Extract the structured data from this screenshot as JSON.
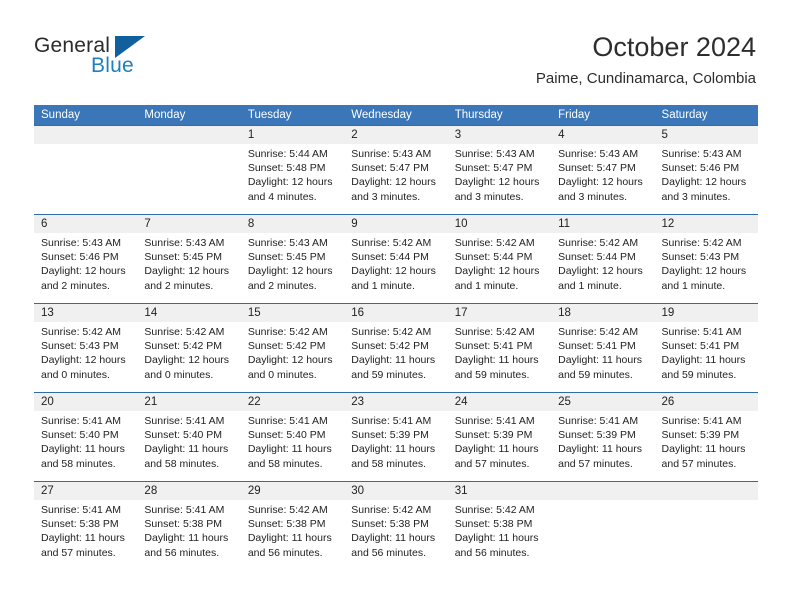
{
  "brand": {
    "word1": "General",
    "word2": "Blue",
    "accent_color": "#11609e",
    "blue_text_color": "#1f7fc4"
  },
  "header": {
    "title": "October 2024",
    "subtitle": "Paime, Cundinamarca, Colombia",
    "header_bg": "#3a76b8",
    "rule_color": "#2f6da8"
  },
  "calendar": {
    "weekdays": [
      "Sunday",
      "Monday",
      "Tuesday",
      "Wednesday",
      "Thursday",
      "Friday",
      "Saturday"
    ],
    "weeks": [
      [
        {
          "day": "",
          "sunrise": "",
          "sunset": "",
          "daylight1": "",
          "daylight2": ""
        },
        {
          "day": "",
          "sunrise": "",
          "sunset": "",
          "daylight1": "",
          "daylight2": ""
        },
        {
          "day": "1",
          "sunrise": "Sunrise: 5:44 AM",
          "sunset": "Sunset: 5:48 PM",
          "daylight1": "Daylight: 12 hours",
          "daylight2": "and 4 minutes."
        },
        {
          "day": "2",
          "sunrise": "Sunrise: 5:43 AM",
          "sunset": "Sunset: 5:47 PM",
          "daylight1": "Daylight: 12 hours",
          "daylight2": "and 3 minutes."
        },
        {
          "day": "3",
          "sunrise": "Sunrise: 5:43 AM",
          "sunset": "Sunset: 5:47 PM",
          "daylight1": "Daylight: 12 hours",
          "daylight2": "and 3 minutes."
        },
        {
          "day": "4",
          "sunrise": "Sunrise: 5:43 AM",
          "sunset": "Sunset: 5:47 PM",
          "daylight1": "Daylight: 12 hours",
          "daylight2": "and 3 minutes."
        },
        {
          "day": "5",
          "sunrise": "Sunrise: 5:43 AM",
          "sunset": "Sunset: 5:46 PM",
          "daylight1": "Daylight: 12 hours",
          "daylight2": "and 3 minutes."
        }
      ],
      [
        {
          "day": "6",
          "sunrise": "Sunrise: 5:43 AM",
          "sunset": "Sunset: 5:46 PM",
          "daylight1": "Daylight: 12 hours",
          "daylight2": "and 2 minutes."
        },
        {
          "day": "7",
          "sunrise": "Sunrise: 5:43 AM",
          "sunset": "Sunset: 5:45 PM",
          "daylight1": "Daylight: 12 hours",
          "daylight2": "and 2 minutes."
        },
        {
          "day": "8",
          "sunrise": "Sunrise: 5:43 AM",
          "sunset": "Sunset: 5:45 PM",
          "daylight1": "Daylight: 12 hours",
          "daylight2": "and 2 minutes."
        },
        {
          "day": "9",
          "sunrise": "Sunrise: 5:42 AM",
          "sunset": "Sunset: 5:44 PM",
          "daylight1": "Daylight: 12 hours",
          "daylight2": "and 1 minute."
        },
        {
          "day": "10",
          "sunrise": "Sunrise: 5:42 AM",
          "sunset": "Sunset: 5:44 PM",
          "daylight1": "Daylight: 12 hours",
          "daylight2": "and 1 minute."
        },
        {
          "day": "11",
          "sunrise": "Sunrise: 5:42 AM",
          "sunset": "Sunset: 5:44 PM",
          "daylight1": "Daylight: 12 hours",
          "daylight2": "and 1 minute."
        },
        {
          "day": "12",
          "sunrise": "Sunrise: 5:42 AM",
          "sunset": "Sunset: 5:43 PM",
          "daylight1": "Daylight: 12 hours",
          "daylight2": "and 1 minute."
        }
      ],
      [
        {
          "day": "13",
          "sunrise": "Sunrise: 5:42 AM",
          "sunset": "Sunset: 5:43 PM",
          "daylight1": "Daylight: 12 hours",
          "daylight2": "and 0 minutes."
        },
        {
          "day": "14",
          "sunrise": "Sunrise: 5:42 AM",
          "sunset": "Sunset: 5:42 PM",
          "daylight1": "Daylight: 12 hours",
          "daylight2": "and 0 minutes."
        },
        {
          "day": "15",
          "sunrise": "Sunrise: 5:42 AM",
          "sunset": "Sunset: 5:42 PM",
          "daylight1": "Daylight: 12 hours",
          "daylight2": "and 0 minutes."
        },
        {
          "day": "16",
          "sunrise": "Sunrise: 5:42 AM",
          "sunset": "Sunset: 5:42 PM",
          "daylight1": "Daylight: 11 hours",
          "daylight2": "and 59 minutes."
        },
        {
          "day": "17",
          "sunrise": "Sunrise: 5:42 AM",
          "sunset": "Sunset: 5:41 PM",
          "daylight1": "Daylight: 11 hours",
          "daylight2": "and 59 minutes."
        },
        {
          "day": "18",
          "sunrise": "Sunrise: 5:42 AM",
          "sunset": "Sunset: 5:41 PM",
          "daylight1": "Daylight: 11 hours",
          "daylight2": "and 59 minutes."
        },
        {
          "day": "19",
          "sunrise": "Sunrise: 5:41 AM",
          "sunset": "Sunset: 5:41 PM",
          "daylight1": "Daylight: 11 hours",
          "daylight2": "and 59 minutes."
        }
      ],
      [
        {
          "day": "20",
          "sunrise": "Sunrise: 5:41 AM",
          "sunset": "Sunset: 5:40 PM",
          "daylight1": "Daylight: 11 hours",
          "daylight2": "and 58 minutes."
        },
        {
          "day": "21",
          "sunrise": "Sunrise: 5:41 AM",
          "sunset": "Sunset: 5:40 PM",
          "daylight1": "Daylight: 11 hours",
          "daylight2": "and 58 minutes."
        },
        {
          "day": "22",
          "sunrise": "Sunrise: 5:41 AM",
          "sunset": "Sunset: 5:40 PM",
          "daylight1": "Daylight: 11 hours",
          "daylight2": "and 58 minutes."
        },
        {
          "day": "23",
          "sunrise": "Sunrise: 5:41 AM",
          "sunset": "Sunset: 5:39 PM",
          "daylight1": "Daylight: 11 hours",
          "daylight2": "and 58 minutes."
        },
        {
          "day": "24",
          "sunrise": "Sunrise: 5:41 AM",
          "sunset": "Sunset: 5:39 PM",
          "daylight1": "Daylight: 11 hours",
          "daylight2": "and 57 minutes."
        },
        {
          "day": "25",
          "sunrise": "Sunrise: 5:41 AM",
          "sunset": "Sunset: 5:39 PM",
          "daylight1": "Daylight: 11 hours",
          "daylight2": "and 57 minutes."
        },
        {
          "day": "26",
          "sunrise": "Sunrise: 5:41 AM",
          "sunset": "Sunset: 5:39 PM",
          "daylight1": "Daylight: 11 hours",
          "daylight2": "and 57 minutes."
        }
      ],
      [
        {
          "day": "27",
          "sunrise": "Sunrise: 5:41 AM",
          "sunset": "Sunset: 5:38 PM",
          "daylight1": "Daylight: 11 hours",
          "daylight2": "and 57 minutes."
        },
        {
          "day": "28",
          "sunrise": "Sunrise: 5:41 AM",
          "sunset": "Sunset: 5:38 PM",
          "daylight1": "Daylight: 11 hours",
          "daylight2": "and 56 minutes."
        },
        {
          "day": "29",
          "sunrise": "Sunrise: 5:42 AM",
          "sunset": "Sunset: 5:38 PM",
          "daylight1": "Daylight: 11 hours",
          "daylight2": "and 56 minutes."
        },
        {
          "day": "30",
          "sunrise": "Sunrise: 5:42 AM",
          "sunset": "Sunset: 5:38 PM",
          "daylight1": "Daylight: 11 hours",
          "daylight2": "and 56 minutes."
        },
        {
          "day": "31",
          "sunrise": "Sunrise: 5:42 AM",
          "sunset": "Sunset: 5:38 PM",
          "daylight1": "Daylight: 11 hours",
          "daylight2": "and 56 minutes."
        },
        {
          "day": "",
          "sunrise": "",
          "sunset": "",
          "daylight1": "",
          "daylight2": ""
        },
        {
          "day": "",
          "sunrise": "",
          "sunset": "",
          "daylight1": "",
          "daylight2": ""
        }
      ]
    ]
  }
}
